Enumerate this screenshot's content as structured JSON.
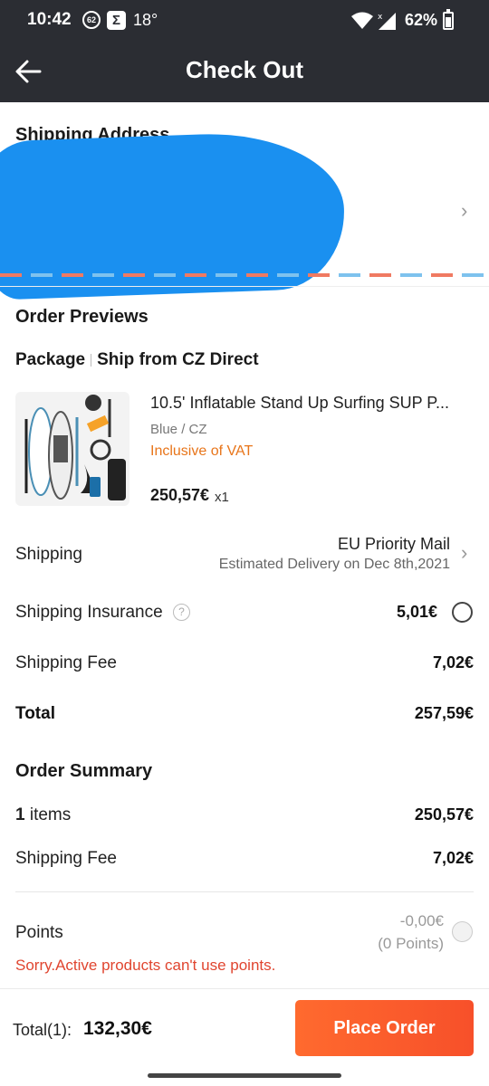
{
  "status_bar": {
    "time": "10:42",
    "notif_count": "62",
    "temperature": "18°",
    "battery": "62%"
  },
  "header": {
    "title": "Check Out"
  },
  "shipping_address": {
    "title": "Shipping Address"
  },
  "order_previews": {
    "title": "Order Previews",
    "package_label": "Package",
    "ship_from": "Ship from CZ Direct",
    "product": {
      "title": "10.5' Inflatable Stand Up Surfing SUP P...",
      "variant": "Blue / CZ",
      "vat_note": "Inclusive of VAT",
      "price": "250,57€",
      "qty": "x1"
    },
    "shipping": {
      "label": "Shipping",
      "method": "EU Priority Mail",
      "estimate": "Estimated Delivery on Dec 8th,2021"
    },
    "insurance": {
      "label": "Shipping Insurance",
      "value": "5,01€"
    },
    "fee": {
      "label": "Shipping Fee",
      "value": "7,02€"
    },
    "total": {
      "label": "Total",
      "value": "257,59€"
    }
  },
  "order_summary": {
    "title": "Order Summary",
    "items_count": "1",
    "items_label": "items",
    "items_value": "250,57€",
    "fee_label": "Shipping Fee",
    "fee_value": "7,02€",
    "points_label": "Points",
    "points_value": "-0,00€",
    "points_sub": "(0 Points)",
    "points_warning": "Sorry.Active products can't use points."
  },
  "bottom_bar": {
    "total_label": "Total(1):",
    "total_amount": "132,30€",
    "place_order": "Place Order"
  },
  "colors": {
    "accent": "#f7502a",
    "header_bg": "#2b2d33",
    "vat_orange": "#e8751a",
    "warning_red": "#e0452f",
    "redaction_blue": "#1a90f0"
  }
}
